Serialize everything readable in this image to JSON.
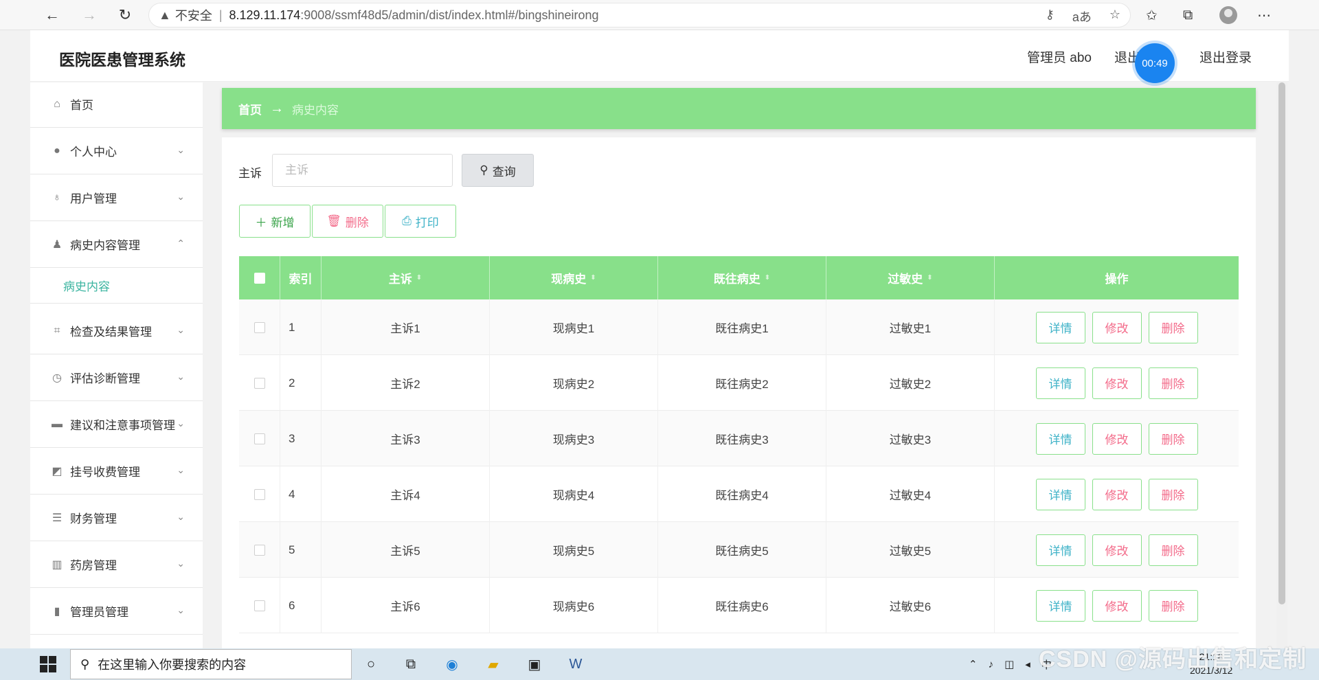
{
  "browser": {
    "insecure_label": "不安全",
    "url_host": "8.129.11.174",
    "url_path": ":9008/ssmf48d5/admin/dist/index.html#/bingshineirong"
  },
  "header": {
    "title": "医院医患管理系统",
    "user_label": "管理员 abo",
    "exit_partial": "退出",
    "logout": "退出登录",
    "timer": "00:49"
  },
  "sidebar": {
    "items": [
      {
        "label": "首页",
        "icon": "home-icon"
      },
      {
        "label": "个人中心",
        "icon": "user-icon"
      },
      {
        "label": "用户管理",
        "icon": "mic-icon"
      },
      {
        "label": "病史内容管理",
        "icon": "stamp-icon"
      },
      {
        "label": "检查及结果管理",
        "icon": "crop-icon"
      },
      {
        "label": "评估诊断管理",
        "icon": "clock-icon"
      },
      {
        "label": "建议和注意事项管理",
        "icon": "briefcase-icon"
      },
      {
        "label": "挂号收费管理",
        "icon": "chart-icon"
      },
      {
        "label": "财务管理",
        "icon": "list-icon"
      },
      {
        "label": "药房管理",
        "icon": "building-icon"
      },
      {
        "label": "管理员管理",
        "icon": "bars-icon"
      }
    ],
    "submenu": {
      "label": "病史内容"
    }
  },
  "breadcrumb": {
    "home": "首页",
    "arrow": "→",
    "current": "病史内容"
  },
  "search": {
    "label": "主诉",
    "placeholder": "主诉",
    "button": "查询"
  },
  "toolbar": {
    "add": "新增",
    "delete": "删除",
    "print": "打印"
  },
  "table": {
    "headers": [
      "索引",
      "主诉",
      "现病史",
      "既往病史",
      "过敏史",
      "操作"
    ],
    "rows": [
      {
        "index": "1",
        "complaint": "主诉1",
        "present": "现病史1",
        "past": "既往病史1",
        "allergy": "过敏史1"
      },
      {
        "index": "2",
        "complaint": "主诉2",
        "present": "现病史2",
        "past": "既往病史2",
        "allergy": "过敏史2"
      },
      {
        "index": "3",
        "complaint": "主诉3",
        "present": "现病史3",
        "past": "既往病史3",
        "allergy": "过敏史3"
      },
      {
        "index": "4",
        "complaint": "主诉4",
        "present": "现病史4",
        "past": "既往病史4",
        "allergy": "过敏史4"
      },
      {
        "index": "5",
        "complaint": "主诉5",
        "present": "现病史5",
        "past": "既往病史5",
        "allergy": "过敏史5"
      },
      {
        "index": "6",
        "complaint": "主诉6",
        "present": "现病史6",
        "past": "既往病史6",
        "allergy": "过敏史6"
      }
    ],
    "actions": {
      "detail": "详情",
      "edit": "修改",
      "delete": "删除"
    }
  },
  "taskbar": {
    "search_placeholder": "在这里输入你要搜索的内容",
    "time": "21:18",
    "date": "2021/3/12",
    "ime": "中"
  },
  "watermark": "CSDN @源码出售和定制",
  "colors": {
    "accent": "#88e08a",
    "detail": "#40b3c8",
    "danger": "#f36b8a",
    "submenu": "#3bb4a0"
  }
}
